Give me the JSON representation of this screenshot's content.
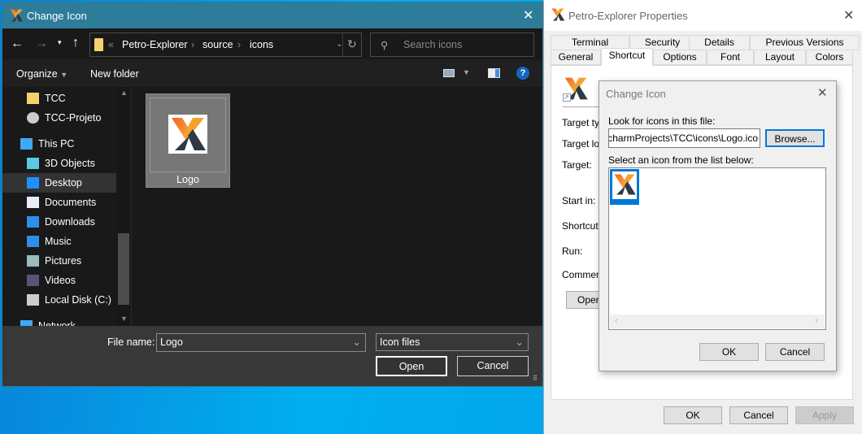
{
  "file_dialog": {
    "title": "Change Icon",
    "breadcrumb": [
      "Petro-Explorer",
      "source",
      "icons"
    ],
    "breadcrumb_prefix": "«",
    "search_placeholder": "Search icons",
    "toolbar": {
      "organize": "Organize",
      "new_folder": "New folder"
    },
    "sidebar": [
      {
        "label": "TCC",
        "icon": "folder-icon"
      },
      {
        "label": "TCC-Projeto",
        "icon": "clock-icon"
      },
      {
        "label": "This PC",
        "icon": "computer-icon"
      },
      {
        "label": "3D Objects",
        "icon": "cube-icon"
      },
      {
        "label": "Desktop",
        "icon": "desktop-icon",
        "selected": true
      },
      {
        "label": "Documents",
        "icon": "document-icon"
      },
      {
        "label": "Downloads",
        "icon": "download-icon"
      },
      {
        "label": "Music",
        "icon": "music-icon"
      },
      {
        "label": "Pictures",
        "icon": "pictures-icon"
      },
      {
        "label": "Videos",
        "icon": "videos-icon"
      },
      {
        "label": "Local Disk (C:)",
        "icon": "disk-icon"
      },
      {
        "label": "Network",
        "icon": "network-icon"
      }
    ],
    "files": [
      {
        "name": "Logo",
        "selected": true
      }
    ],
    "file_name_label": "File name:",
    "file_name_value": "Logo",
    "file_type": "Icon files",
    "open": "Open",
    "cancel": "Cancel"
  },
  "properties": {
    "title": "Petro-Explorer Properties",
    "tabs_row1": [
      "Terminal",
      "Security",
      "Details",
      "Previous Versions"
    ],
    "tabs_row2": [
      "General",
      "Shortcut",
      "Options",
      "Font",
      "Layout",
      "Colors"
    ],
    "active_tab": "Shortcut",
    "fields": [
      "Target typ",
      "Target loc",
      "Target:",
      "Start in:",
      "Shortcut k",
      "Run:",
      "Comment:"
    ],
    "open_button": "Open",
    "ok": "OK",
    "cancel": "Cancel",
    "apply": "Apply"
  },
  "change_icon": {
    "title": "Change Icon",
    "look_label": "Look for icons in this file:",
    "path": "'ycharmProjects\\TCC\\icons\\Logo.ico",
    "browse": "Browse...",
    "select_label": "Select an icon from the list below:",
    "ok": "OK",
    "cancel": "Cancel"
  },
  "colors": {
    "title_bar": "#2d7d9a",
    "accent": "#0078d7",
    "logo_orange": "#f7931e",
    "logo_dark": "#2f3a45"
  }
}
